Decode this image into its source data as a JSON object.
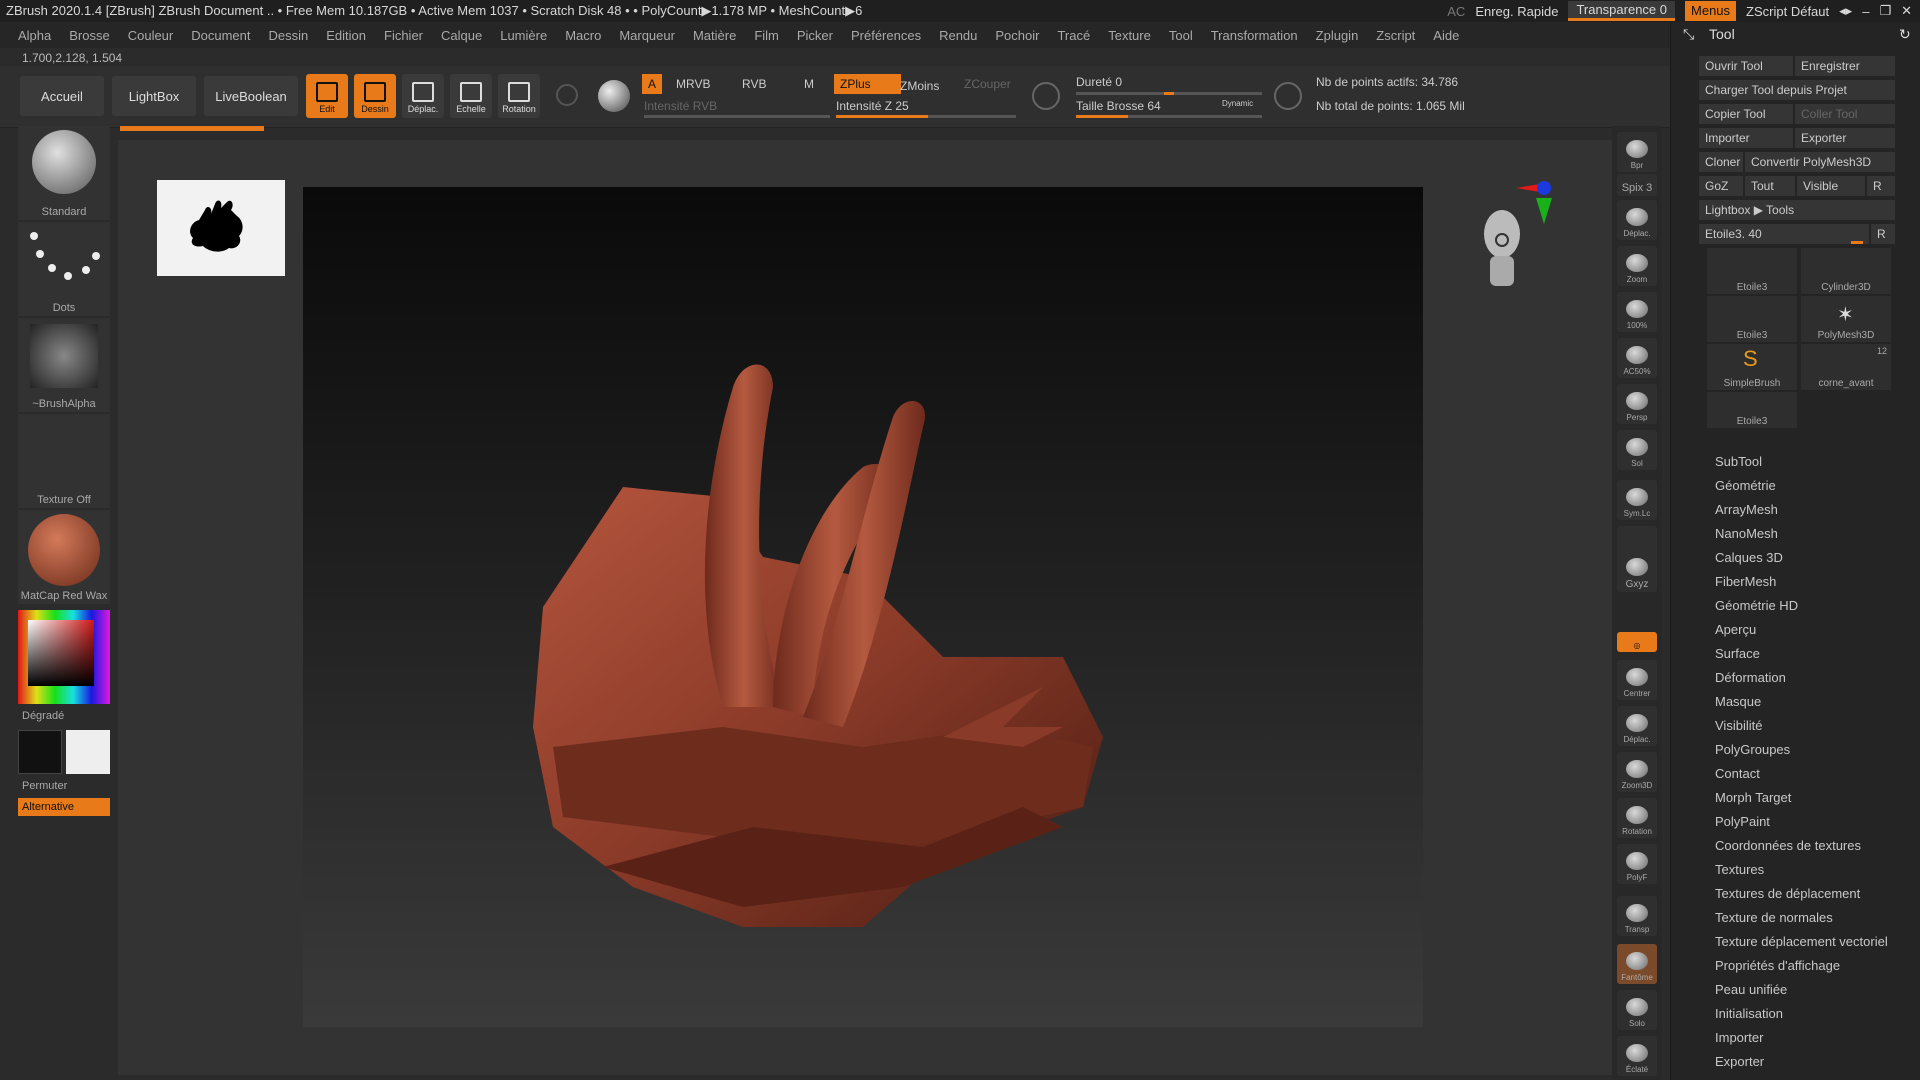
{
  "titlebar": {
    "text": "ZBrush 2020.1.4 [ZBrush]   ZBrush Document     .. • Free Mem 10.187GB • Active Mem 1037 • Scratch Disk 48 • • PolyCount▶1.178 MP • MeshCount▶6",
    "ac": "AC",
    "quick_save": "Enreg. Rapide",
    "transparency": "Transparence 0",
    "menus": "Menus",
    "zscript_default": "ZScript Défaut"
  },
  "menubar": [
    "Alpha",
    "Brosse",
    "Couleur",
    "Document",
    "Dessin",
    "Edition",
    "Fichier",
    "Calque",
    "Lumière",
    "Macro",
    "Marqueur",
    "Matière",
    "Film",
    "Picker",
    "Préférences",
    "Rendu",
    "Pochoir",
    "Tracé",
    "Texture",
    "Tool",
    "Transformation",
    "Zplugin",
    "Zscript",
    "Aide"
  ],
  "coords": "1.700,2.128, 1.504",
  "shelf": {
    "home": "Accueil",
    "lightbox": "LightBox",
    "liveboolean": "LiveBoolean",
    "tools": [
      "Edit",
      "Dessin",
      "Déplac.",
      "Echelle",
      "Rotation"
    ],
    "a_label": "A",
    "mrvb": "MRVB",
    "rvb": "RVB",
    "m": "M",
    "rgb_intensity": "Intensité RVB",
    "zplus": "ZPlus",
    "zminus": "ZMoins",
    "zcut": "ZCouper",
    "z_intensity": "Intensité Z 25",
    "hardness": "Dureté 0",
    "brush_size": "Taille Brosse 64",
    "dynamic": "Dynamic",
    "active_points": "Nb de points actifs: 34.786",
    "total_points": "Nb total de points: 1.065 Mil"
  },
  "left": {
    "brush": "Standard",
    "stroke": "Dots",
    "alpha": "~BrushAlpha",
    "texture": "Texture Off",
    "material": "MatCap Red Wax",
    "gradient": "Dégradé",
    "switch": "Permuter",
    "alternate": "Alternative"
  },
  "right_tools": [
    "Bpr",
    "Spix 3",
    "Déplac.",
    "Zoom",
    "100%",
    "AC50%",
    "Persp",
    "Sol",
    "Sym.Lc",
    "Gxyz",
    "",
    "Centrer",
    "Déplac.",
    "Zoom3D",
    "Rotation",
    "PolyF",
    "Transp",
    "Fantôme",
    "Solo",
    "Éclaté"
  ],
  "tool_panel": {
    "title": "Tool",
    "open_tool": "Ouvrir Tool",
    "save": "Enregistrer",
    "load_from_project": "Charger Tool depuis Projet",
    "copy_tool": "Copier Tool",
    "paste_tool": "Coller Tool",
    "import": "Importer",
    "export": "Exporter",
    "clone": "Cloner",
    "convert": "Convertir PolyMesh3D",
    "goz": "GoZ",
    "all": "Tout",
    "visible": "Visible",
    "r": "R",
    "lightbox_tools": "Lightbox ▶ Tools",
    "star_slider": "Etoile3. 40",
    "tiles": [
      "Etoile3",
      "Cylinder3D",
      "Etoile3",
      "PolyMesh3D",
      "SimpleBrush",
      "corne_avant",
      "Etoile3"
    ],
    "tile_count": "12",
    "subpalettes": [
      "SubTool",
      "Géométrie",
      "ArrayMesh",
      "NanoMesh",
      "Calques 3D",
      "FiberMesh",
      "Géométrie HD",
      "Aperçu",
      "Surface",
      "Déformation",
      "Masque",
      "Visibilité",
      "PolyGroupes",
      "Contact",
      "Morph Target",
      "PolyPaint",
      "Coordonnées de textures",
      "Textures",
      "Textures de déplacement",
      "Texture de normales",
      "Texture déplacement vectoriel",
      "Propriétés d'affichage",
      "Peau unifiée",
      "Initialisation",
      "Importer",
      "Exporter"
    ]
  }
}
